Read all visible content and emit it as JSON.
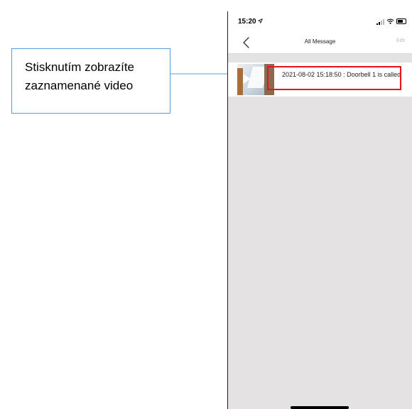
{
  "annotation": {
    "callout_lines": [
      "Stisknutím zobrazíte",
      "zaznamenané video"
    ],
    "border_color": "#5b9bd5",
    "highlight_color": "#e3161e"
  },
  "status_bar": {
    "time": "15:20",
    "location_icon": "location-arrow-icon",
    "signal_icon": "cellular-signal-icon",
    "wifi_icon": "wifi-icon",
    "battery_icon": "battery-icon"
  },
  "nav": {
    "back_icon": "chevron-left-icon",
    "title": "All Message",
    "edit_label": "Edit"
  },
  "messages": [
    {
      "thumbnail_icon": "video-play-icon",
      "text": "2021-08-02 15:18:50 : Doorbell 1 is called"
    }
  ],
  "colors": {
    "list_background": "#e4e2e3",
    "edit_label": "#b9b9b9"
  }
}
